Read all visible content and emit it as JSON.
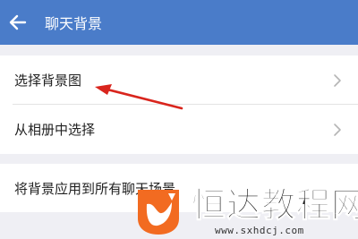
{
  "header": {
    "title": "聊天背景",
    "back_icon": "arrow-left-icon",
    "background": "#4a7cc9"
  },
  "settings": {
    "items": [
      {
        "label": "选择背景图",
        "icon": "chevron-right-icon"
      },
      {
        "label": "从相册中选择",
        "icon": "chevron-right-icon"
      }
    ],
    "apply_all_label": "将背景应用到所有聊天场景"
  },
  "annotation": {
    "icon": "red-arrow-icon",
    "color": "#d9251d"
  },
  "watermark": {
    "title": "恒达教程网",
    "url": "www.sxhdcj.com",
    "logo_color": "#f26b21"
  }
}
